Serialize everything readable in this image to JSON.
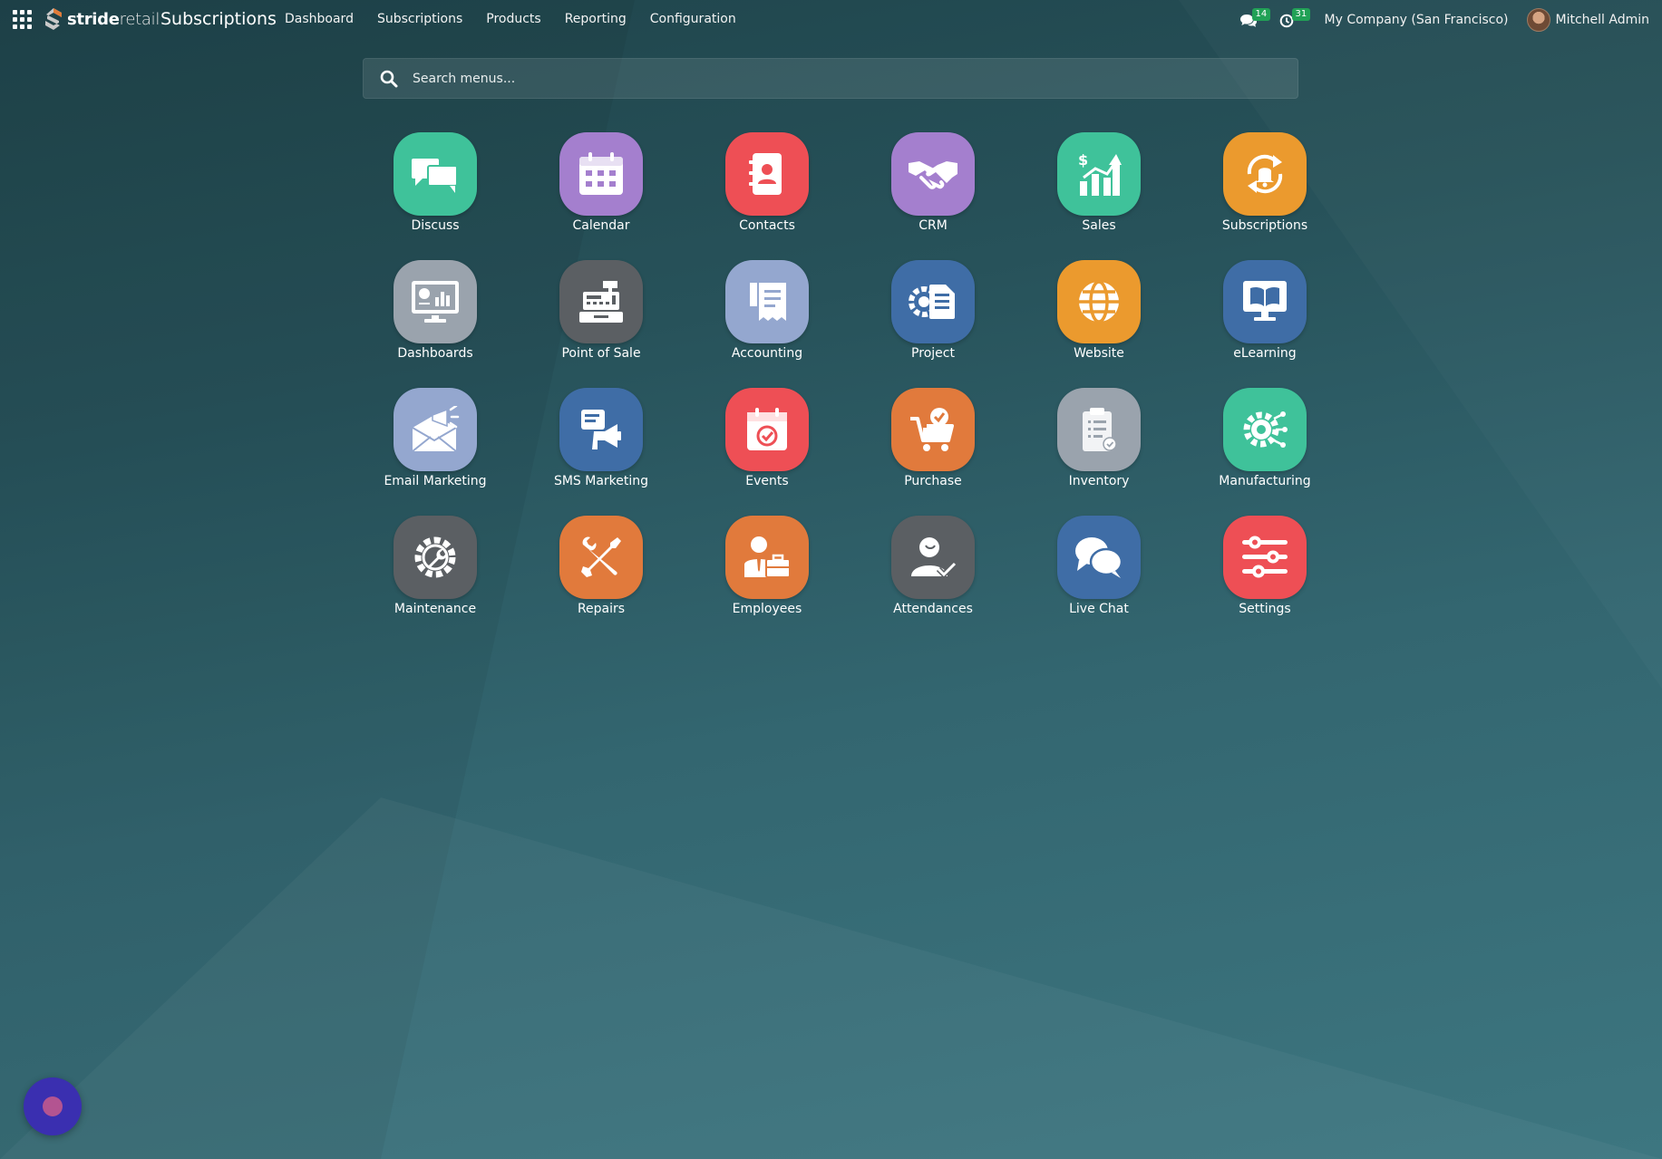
{
  "header": {
    "brand_bold": "stride",
    "brand_light": "retail",
    "app_title": "Subscriptions",
    "nav": [
      "Dashboard",
      "Subscriptions",
      "Products",
      "Reporting",
      "Configuration"
    ],
    "messages_count": "14",
    "activities_count": "31",
    "company": "My Company (San Francisco)",
    "user": "Mitchell Admin"
  },
  "search": {
    "placeholder": "Search menus..."
  },
  "apps": [
    {
      "label": "Discuss",
      "color": "#3fc29a",
      "icon": "discuss-icon"
    },
    {
      "label": "Calendar",
      "color": "#a47fce",
      "icon": "calendar-icon"
    },
    {
      "label": "Contacts",
      "color": "#ee4f55",
      "icon": "contacts-icon"
    },
    {
      "label": "CRM",
      "color": "#a47fce",
      "icon": "handshake-icon"
    },
    {
      "label": "Sales",
      "color": "#3fc29a",
      "icon": "sales-chart-icon"
    },
    {
      "label": "Subscriptions",
      "color": "#eb9a2e",
      "icon": "subscription-bell-icon"
    },
    {
      "label": "Dashboards",
      "color": "#9aa3ad",
      "icon": "dashboard-monitor-icon"
    },
    {
      "label": "Point of Sale",
      "color": "#5b5f63",
      "icon": "cash-register-icon"
    },
    {
      "label": "Accounting",
      "color": "#94a7cf",
      "icon": "receipt-icon"
    },
    {
      "label": "Project",
      "color": "#3f6da6",
      "icon": "project-gear-icon"
    },
    {
      "label": "Website",
      "color": "#eb9a2e",
      "icon": "globe-icon"
    },
    {
      "label": "eLearning",
      "color": "#3f6da6",
      "icon": "book-screen-icon"
    },
    {
      "label": "Email Marketing",
      "color": "#94a7cf",
      "icon": "email-megaphone-icon"
    },
    {
      "label": "SMS Marketing",
      "color": "#3f6da6",
      "icon": "sms-megaphone-icon"
    },
    {
      "label": "Events",
      "color": "#ee4f55",
      "icon": "event-calendar-icon"
    },
    {
      "label": "Purchase",
      "color": "#e17a3c",
      "icon": "shopping-cart-icon"
    },
    {
      "label": "Inventory",
      "color": "#9aa3ad",
      "icon": "clipboard-icon"
    },
    {
      "label": "Manufacturing",
      "color": "#3fc29a",
      "icon": "manufacturing-gear-icon"
    },
    {
      "label": "Maintenance",
      "color": "#5b5f63",
      "icon": "wrench-gear-icon"
    },
    {
      "label": "Repairs",
      "color": "#e17a3c",
      "icon": "tools-icon"
    },
    {
      "label": "Employees",
      "color": "#e17a3c",
      "icon": "employee-briefcase-icon"
    },
    {
      "label": "Attendances",
      "color": "#5b5f63",
      "icon": "user-check-icon"
    },
    {
      "label": "Live Chat",
      "color": "#3f6da6",
      "icon": "chat-bubbles-icon"
    },
    {
      "label": "Settings",
      "color": "#ee4f55",
      "icon": "sliders-icon"
    }
  ]
}
